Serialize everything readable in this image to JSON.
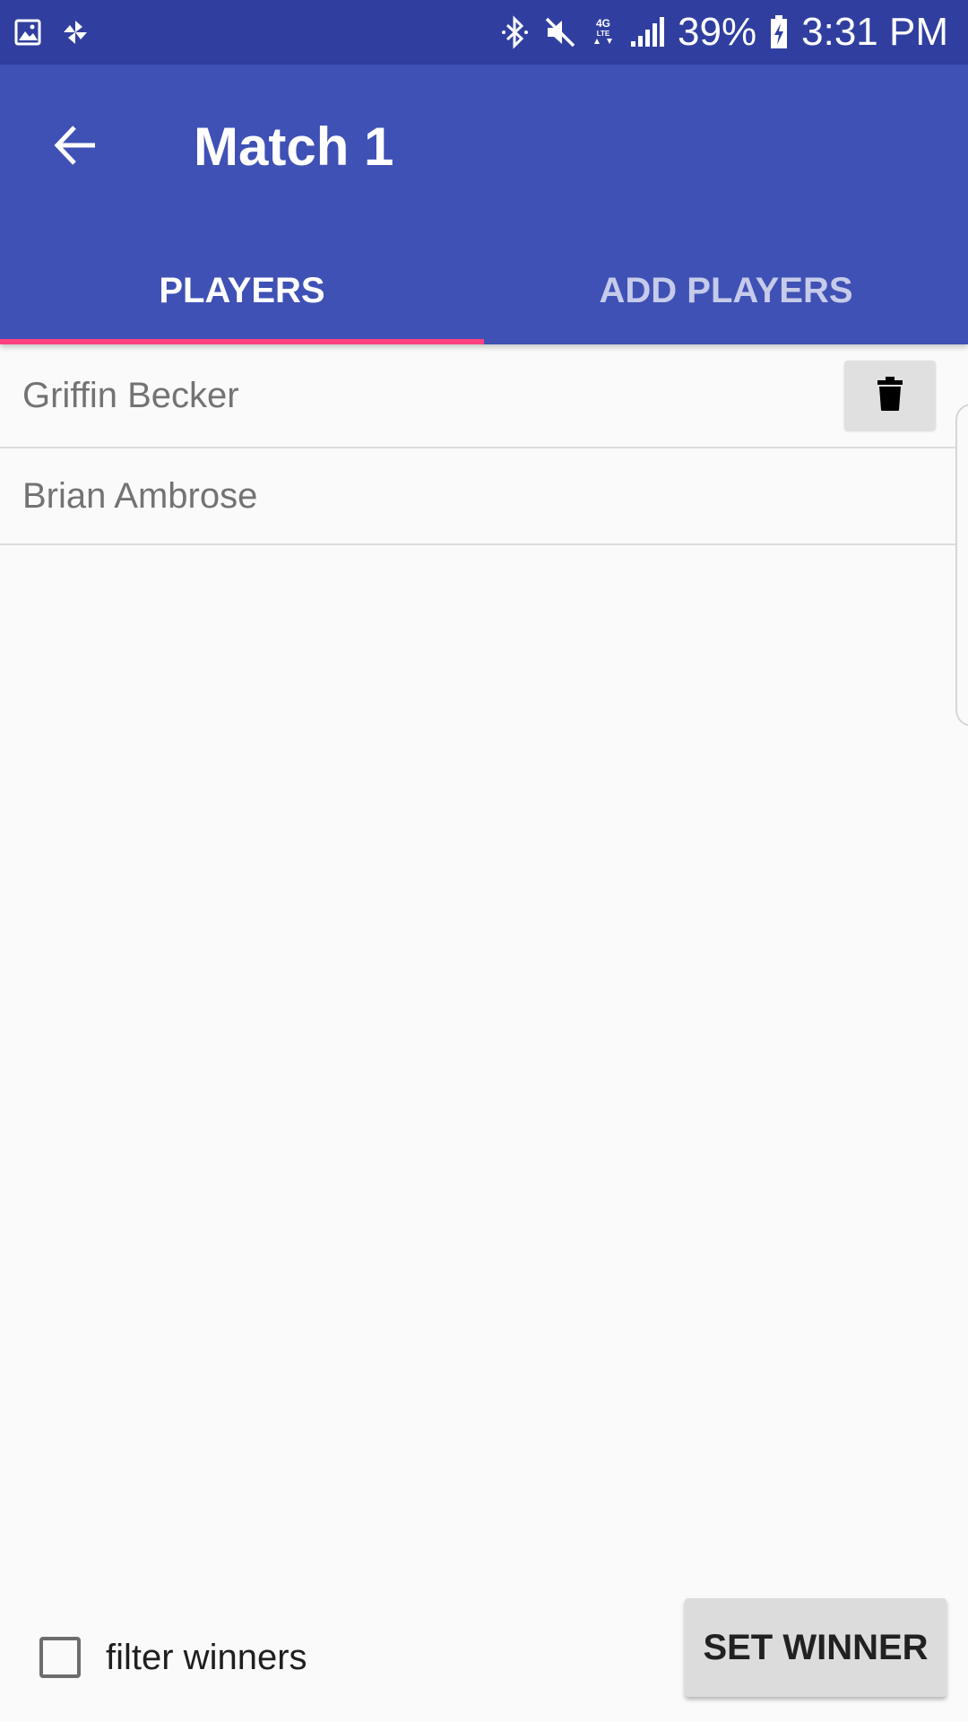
{
  "status_bar": {
    "battery": "39%",
    "time": "3:31 PM",
    "icons_left": [
      "picture-icon",
      "pinwheel-icon"
    ],
    "icons_right": [
      "bluetooth-icon",
      "mute-icon",
      "4g-lte-icon",
      "signal-icon",
      "battery-charging-icon"
    ]
  },
  "app_bar": {
    "title": "Match 1",
    "back_icon": "arrow-back-icon",
    "color": "#3f51b5",
    "status_color": "#303f9f"
  },
  "tabs": [
    {
      "label": "PLAYERS",
      "selected": true
    },
    {
      "label": "ADD PLAYERS",
      "selected": false
    }
  ],
  "tab_indicator_color": "#ff4081",
  "players": [
    {
      "name": "Griffin Becker",
      "has_delete": true
    },
    {
      "name": "Brian Ambrose",
      "has_delete": false
    }
  ],
  "delete_icon": "trash-icon",
  "footer": {
    "filter_label": "filter winners",
    "filter_checked": false,
    "set_winner_label": "SET WINNER"
  }
}
